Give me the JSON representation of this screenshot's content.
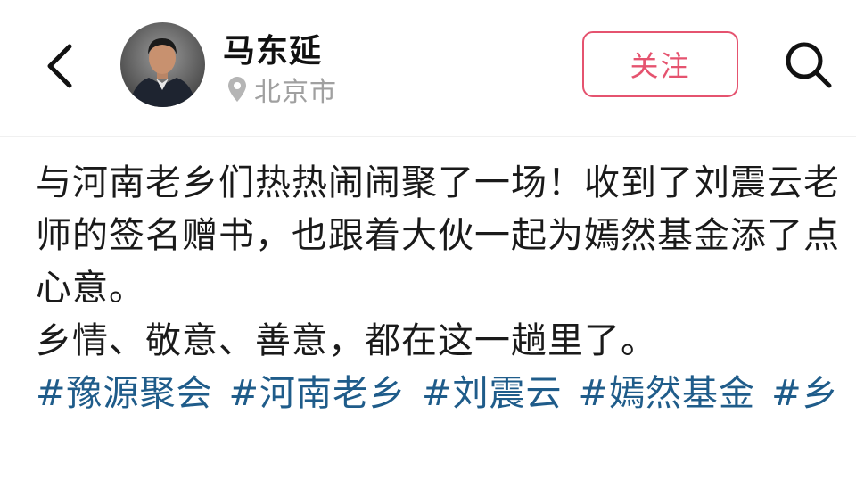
{
  "profile": {
    "name": "马东延",
    "location": "北京市",
    "follow_label": "关注"
  },
  "icons": {
    "back": "chevron-left-icon",
    "location": "location-pin-icon",
    "search": "search-icon"
  },
  "post": {
    "paragraph1": "与河南老乡们热热闹闹聚了一场！收到了刘震云老师的签名赠书，也跟着大伙一起为嫣然基金添了点心意。",
    "paragraph2": "乡情、敬意、善意，都在这一趟里了。",
    "hashtags": [
      "#豫源聚会",
      "#河南老乡",
      "#刘震云",
      "#嫣然基金",
      "#乡"
    ]
  },
  "colors": {
    "accent": "#e5536f",
    "hashtag": "#1f5c8a",
    "muted": "#a0a0a0"
  }
}
